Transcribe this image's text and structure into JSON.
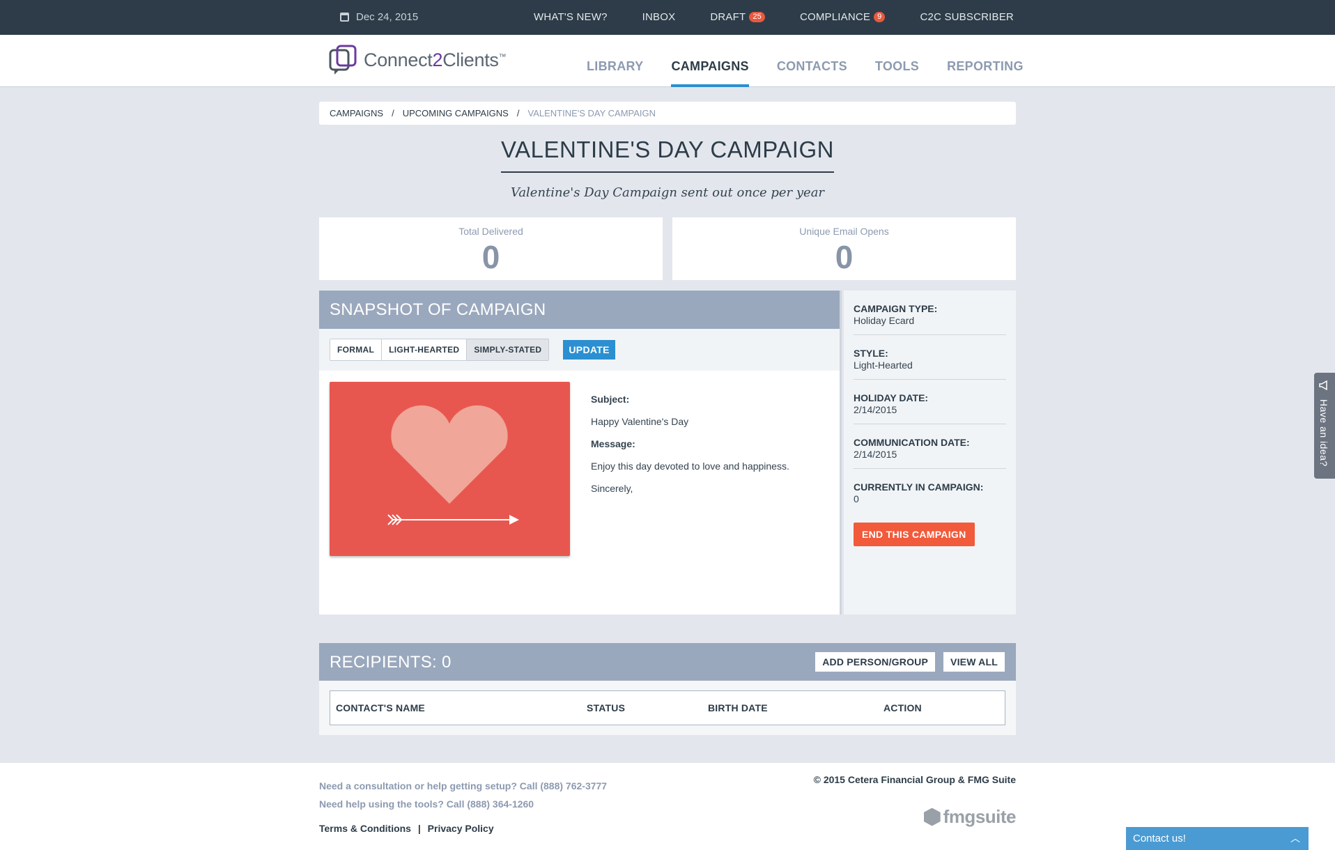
{
  "topbar": {
    "date": "Dec 24, 2015",
    "nav": [
      {
        "label": "WHAT'S NEW?",
        "badge": ""
      },
      {
        "label": "INBOX",
        "badge": ""
      },
      {
        "label": "DRAFT",
        "badge": "25"
      },
      {
        "label": "COMPLIANCE",
        "badge": "9"
      },
      {
        "label": "C2C SUBSCRIBER",
        "badge": ""
      }
    ]
  },
  "logo": {
    "part1": "Connect",
    "part2": "2",
    "part3": "Clients",
    "tm": "™"
  },
  "mainnav": [
    "LIBRARY",
    "CAMPAIGNS",
    "CONTACTS",
    "TOOLS",
    "REPORTING"
  ],
  "breadcrumb": {
    "items": [
      "CAMPAIGNS",
      "UPCOMING CAMPAIGNS"
    ],
    "sep": "/",
    "current": "VALENTINE'S DAY CAMPAIGN"
  },
  "title": "VALENTINE'S DAY CAMPAIGN",
  "subtitle": "Valentine's Day Campaign sent out once per year",
  "stats": [
    {
      "label": "Total Delivered",
      "value": "0"
    },
    {
      "label": "Unique Email Opens",
      "value": "0"
    }
  ],
  "snapshot": {
    "title": "SNAPSHOT OF CAMPAIGN",
    "styles": [
      "FORMAL",
      "LIGHT-HEARTED",
      "SIMPLY-STATED"
    ],
    "selected_style": "SIMPLY-STATED",
    "update_label": "UPDATE",
    "subject_label": "Subject:",
    "subject": "Happy Valentine's Day",
    "message_label": "Message:",
    "message": "Enjoy this day devoted to love and happiness.",
    "closing": "Sincerely,",
    "card_color": "#e8574f",
    "heart_color": "#f0a698"
  },
  "info": {
    "rows": [
      {
        "key": "CAMPAIGN TYPE:",
        "value": "Holiday Ecard"
      },
      {
        "key": "STYLE:",
        "value": "Light-Hearted"
      },
      {
        "key": "HOLIDAY DATE:",
        "value": "2/14/2015"
      },
      {
        "key": "COMMUNICATION DATE:",
        "value": "2/14/2015"
      },
      {
        "key": "CURRENTLY IN CAMPAIGN:",
        "value": "0"
      }
    ],
    "end_label": "END THIS CAMPAIGN"
  },
  "recipients": {
    "title": "RECIPIENTS: 0",
    "add_label": "ADD PERSON/GROUP",
    "view_all_label": "VIEW ALL",
    "columns": [
      "CONTACT'S NAME",
      "STATUS",
      "BIRTH DATE",
      "ACTION"
    ]
  },
  "footer": {
    "help1": "Need a consultation or help getting setup? Call (888) 762-3777",
    "help2": "Need help using the tools? Call (888) 364-1260",
    "terms": "Terms & Conditions",
    "divider": "|",
    "privacy": "Privacy Policy",
    "copyright": "© 2015 Cetera Financial Group & FMG Suite",
    "brand": "fmgsuite"
  },
  "contact_us": "Contact us!",
  "idea_tab": "Have an idea?",
  "colors": {
    "accent": "#2b8fd1",
    "danger": "#f15a3a",
    "header_dark": "#2d3c48",
    "section_head": "#9aa8bd"
  }
}
